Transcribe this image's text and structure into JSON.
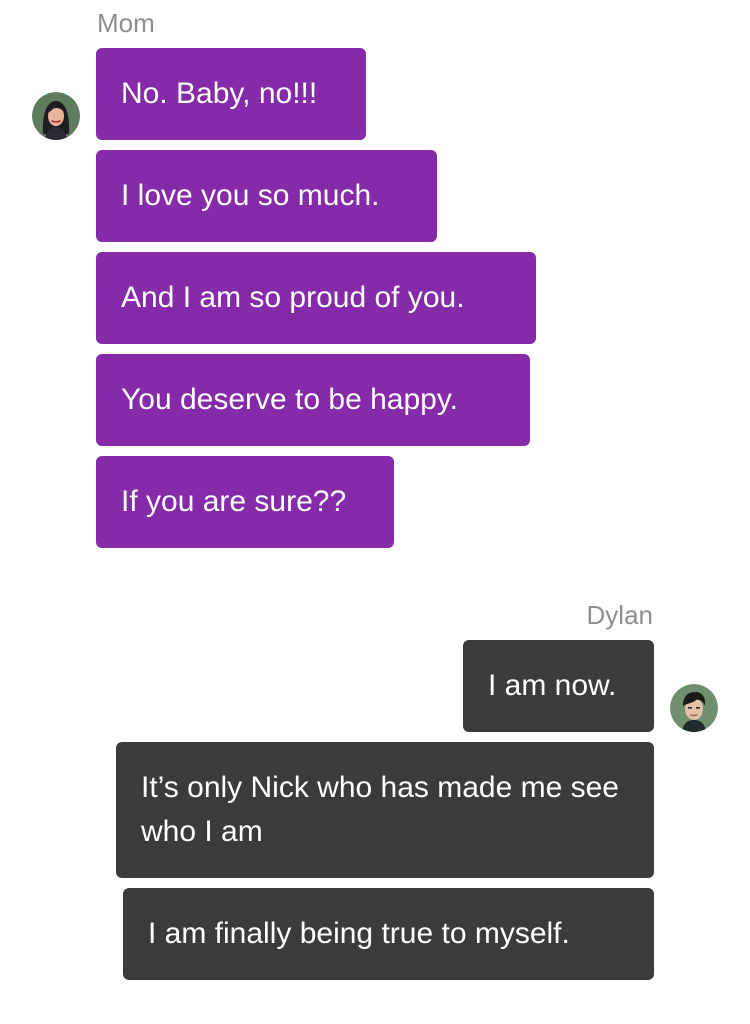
{
  "conversation": {
    "mom": {
      "name": "Mom",
      "avatar_icon": "woman-avatar-icon",
      "bubble_color": "#852aa8",
      "messages": [
        "No. Baby, no!!!",
        "I love you so much.",
        "And I am so proud of you.",
        "You deserve to be happy.",
        "If you are sure??"
      ]
    },
    "dylan": {
      "name": "Dylan",
      "avatar_icon": "man-avatar-icon",
      "bubble_color": "#3b3b3b",
      "messages": [
        "I am now.",
        "It’s only Nick who has made me see who I am",
        "I am finally being true to myself."
      ]
    }
  }
}
